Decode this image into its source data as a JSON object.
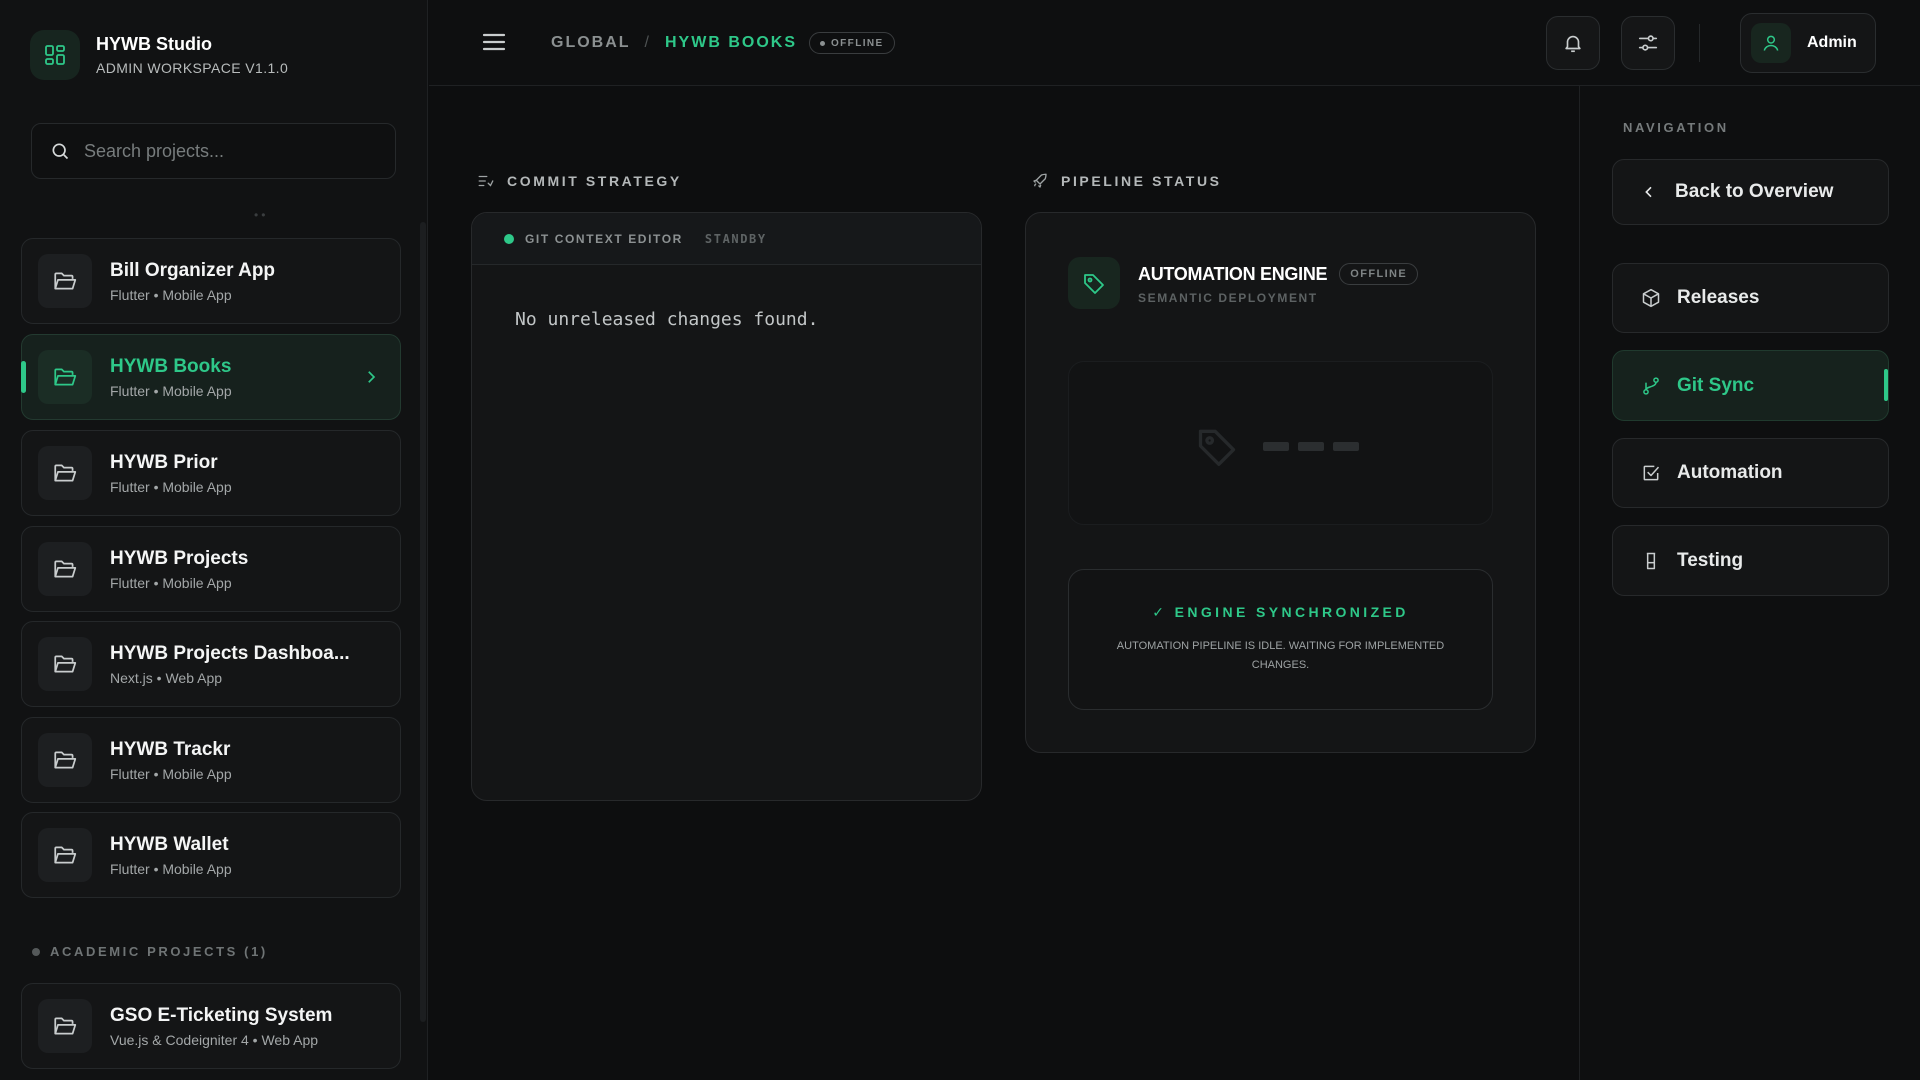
{
  "colors": {
    "accent": "#2ec889",
    "background": "#0d0e0f",
    "panel": "#141516"
  },
  "brand": {
    "title": "HYWB Studio",
    "subtitle": "ADMIN WORKSPACE V1.1.0",
    "icon": "dashboard-grid-icon"
  },
  "search": {
    "placeholder": "Search projects...",
    "value": ""
  },
  "projects": [
    {
      "name": "Bill Organizer App",
      "meta": "Flutter • Mobile App"
    },
    {
      "name": "HYWB Books",
      "meta": "Flutter • Mobile App"
    },
    {
      "name": "HYWB Prior",
      "meta": "Flutter • Mobile App"
    },
    {
      "name": "HYWB Projects",
      "meta": "Flutter • Mobile App"
    },
    {
      "name": "HYWB Projects Dashboa...",
      "meta": "Next.js • Web App"
    },
    {
      "name": "HYWB Trackr",
      "meta": "Flutter • Mobile App"
    },
    {
      "name": "HYWB Wallet",
      "meta": "Flutter • Mobile App"
    }
  ],
  "academic": {
    "label": "ACADEMIC PROJECTS (1)",
    "projects": [
      {
        "name": "GSO E-Ticketing System",
        "meta": "Vue.js & Codeigniter 4 • Web App"
      }
    ]
  },
  "header": {
    "breadcrumb_root": "GLOBAL",
    "breadcrumb_sep": "/",
    "breadcrumb_current": "HYWB BOOKS",
    "status_pill": "OFFLINE",
    "user_label": "Admin"
  },
  "commit": {
    "title": "COMMIT STRATEGY",
    "editor_label": "GIT CONTEXT EDITOR",
    "editor_state": "STANDBY",
    "message": "No unreleased changes found."
  },
  "pipeline": {
    "title": "PIPELINE STATUS",
    "engine_name": "AUTOMATION ENGINE",
    "engine_badge": "OFFLINE",
    "engine_sub": "SEMANTIC DEPLOYMENT",
    "sync_title": "✓ ENGINE SYNCHRONIZED",
    "sync_desc": "AUTOMATION PIPELINE IS IDLE. WAITING FOR IMPLEMENTED CHANGES."
  },
  "nav": {
    "title": "NAVIGATION",
    "back": "Back to Overview",
    "items": [
      {
        "label": "Releases",
        "icon": "package-icon"
      },
      {
        "label": "Git Sync",
        "icon": "git-branch-icon"
      },
      {
        "label": "Automation",
        "icon": "checkbox-icon"
      },
      {
        "label": "Testing",
        "icon": "beaker-icon"
      }
    ]
  }
}
